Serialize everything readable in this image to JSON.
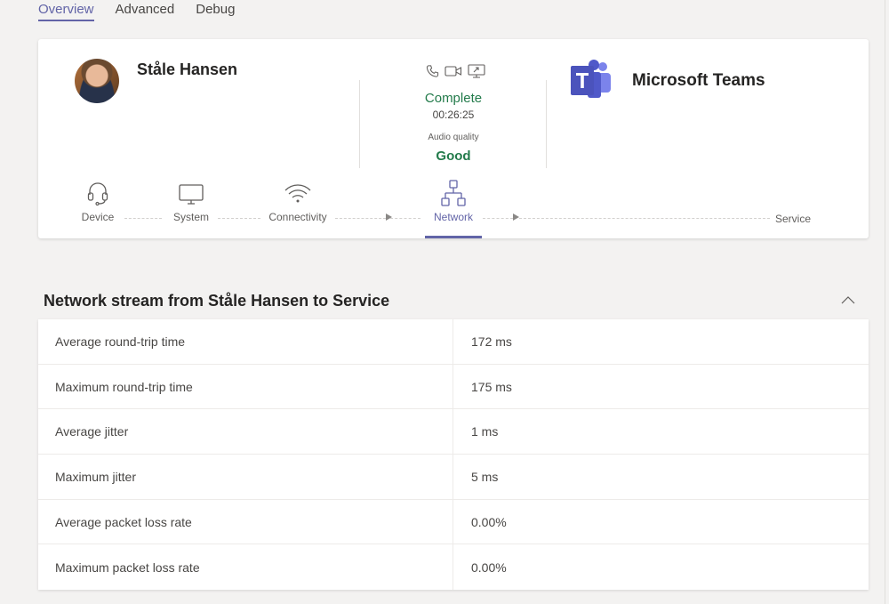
{
  "tabs": [
    {
      "label": "Overview",
      "active": true
    },
    {
      "label": "Advanced",
      "active": false
    },
    {
      "label": "Debug",
      "active": false
    }
  ],
  "participant": {
    "name": "Ståle Hansen",
    "avatar_icon": "user-photo"
  },
  "call": {
    "modality_icons": [
      "phone-icon",
      "video-icon",
      "screen-share-icon"
    ],
    "status": "Complete",
    "duration": "00:26:25",
    "audio_quality_label": "Audio quality",
    "audio_quality_value": "Good",
    "status_color": "#237b4b"
  },
  "service": {
    "name": "Microsoft Teams",
    "logo_icon": "teams-logo",
    "brand_color": "#6264a7"
  },
  "path": {
    "steps": [
      {
        "label": "Device",
        "icon": "headset-icon",
        "active": false
      },
      {
        "label": "System",
        "icon": "monitor-icon",
        "active": false
      },
      {
        "label": "Connectivity",
        "icon": "wifi-icon",
        "active": false
      },
      {
        "label": "Network",
        "icon": "network-icon",
        "active": true
      }
    ],
    "end_label": "Service"
  },
  "section": {
    "title": "Network stream from Ståle Hansen to Service",
    "collapse_icon": "chevron-up-icon",
    "rows": [
      {
        "name": "Average round-trip time",
        "value": "172 ms"
      },
      {
        "name": "Maximum round-trip time",
        "value": "175 ms"
      },
      {
        "name": "Average jitter",
        "value": "1 ms"
      },
      {
        "name": "Maximum jitter",
        "value": "5 ms"
      },
      {
        "name": "Average packet loss rate",
        "value": "0.00%"
      },
      {
        "name": "Maximum packet loss rate",
        "value": "0.00%"
      }
    ]
  }
}
